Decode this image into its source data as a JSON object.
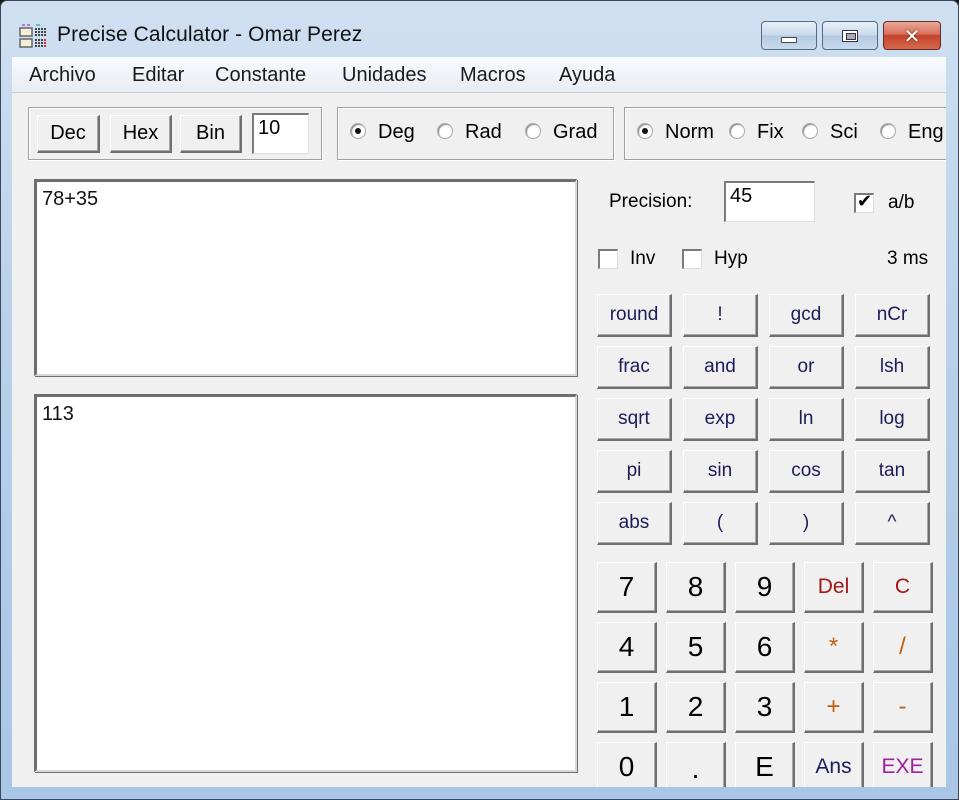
{
  "window": {
    "title": "Precise Calculator - Omar Perez",
    "app_icon": "calculator-app-icon",
    "controls": {
      "minimize": "minimize-icon",
      "maximize": "maximize-icon",
      "close": "close-icon",
      "close_glyph": "✕"
    }
  },
  "menu": [
    "Archivo",
    "Editar",
    "Constante",
    "Unidades",
    "Macros",
    "Ayuda"
  ],
  "base": {
    "buttons": [
      "Dec",
      "Hex",
      "Bin"
    ],
    "radix_value": "10"
  },
  "angle": {
    "options": [
      "Deg",
      "Rad",
      "Grad"
    ],
    "selected": "Deg"
  },
  "format": {
    "options": [
      "Norm",
      "Fix",
      "Sci",
      "Eng"
    ],
    "selected": "Norm"
  },
  "precision": {
    "label": "Precision:",
    "value": "45"
  },
  "fraction": {
    "label": "a/b",
    "checked": true,
    "check_glyph": "✔"
  },
  "inv": {
    "label": "Inv",
    "checked": false
  },
  "hyp": {
    "label": "Hyp",
    "checked": false
  },
  "timing": "3 ms",
  "expression": "78+35",
  "result": "113",
  "function_buttons": [
    [
      "round",
      "!",
      "gcd",
      "nCr"
    ],
    [
      "frac",
      "and",
      "or",
      "lsh"
    ],
    [
      "sqrt",
      "exp",
      "ln",
      "log"
    ],
    [
      "pi",
      "sin",
      "cos",
      "tan"
    ],
    [
      "abs",
      "(",
      ")",
      "^"
    ]
  ],
  "keypad": [
    [
      "7",
      "8",
      "9",
      "Del",
      "C"
    ],
    [
      "4",
      "5",
      "6",
      "*",
      "/"
    ],
    [
      "1",
      "2",
      "3",
      "+",
      "-"
    ],
    [
      "0",
      ".",
      "E",
      "Ans",
      "EXE"
    ]
  ],
  "colors": {
    "function_text": "#1c1c5a",
    "digit_text": "#000000",
    "delete_text": "#a01818",
    "operator_text": "#c06010",
    "ans_text": "#1c1c5a",
    "exe_text": "#a020a0"
  }
}
